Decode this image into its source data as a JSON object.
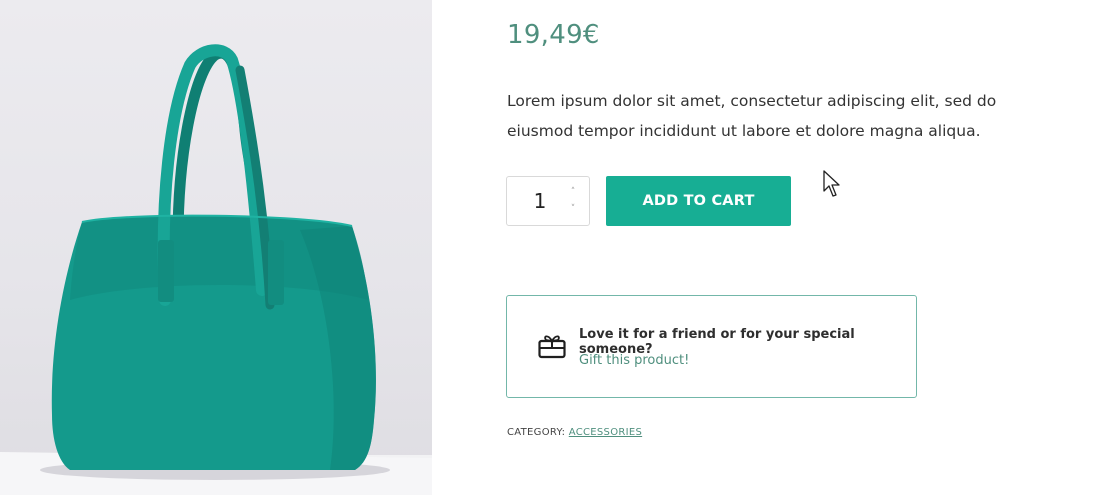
{
  "product": {
    "image_alt": "Teal leather tote bag",
    "price": "19,49€",
    "description": "Lorem ipsum dolor sit amet, consectetur adipiscing elit, sed do eiusmod tempor incididunt ut labore et dolore magna aliqua.",
    "quantity": "1",
    "add_to_cart_label": "ADD TO CART",
    "bag_color": "#14978a"
  },
  "gift": {
    "title": "Love it for a friend or for your special someone?",
    "link": "Gift this product!"
  },
  "meta": {
    "category_label": "CATEGORY:",
    "category_value": "ACCESSORIES"
  },
  "colors": {
    "accent": "#17ae94",
    "price": "#4f8f7e",
    "gift_border": "#73b7a9"
  }
}
